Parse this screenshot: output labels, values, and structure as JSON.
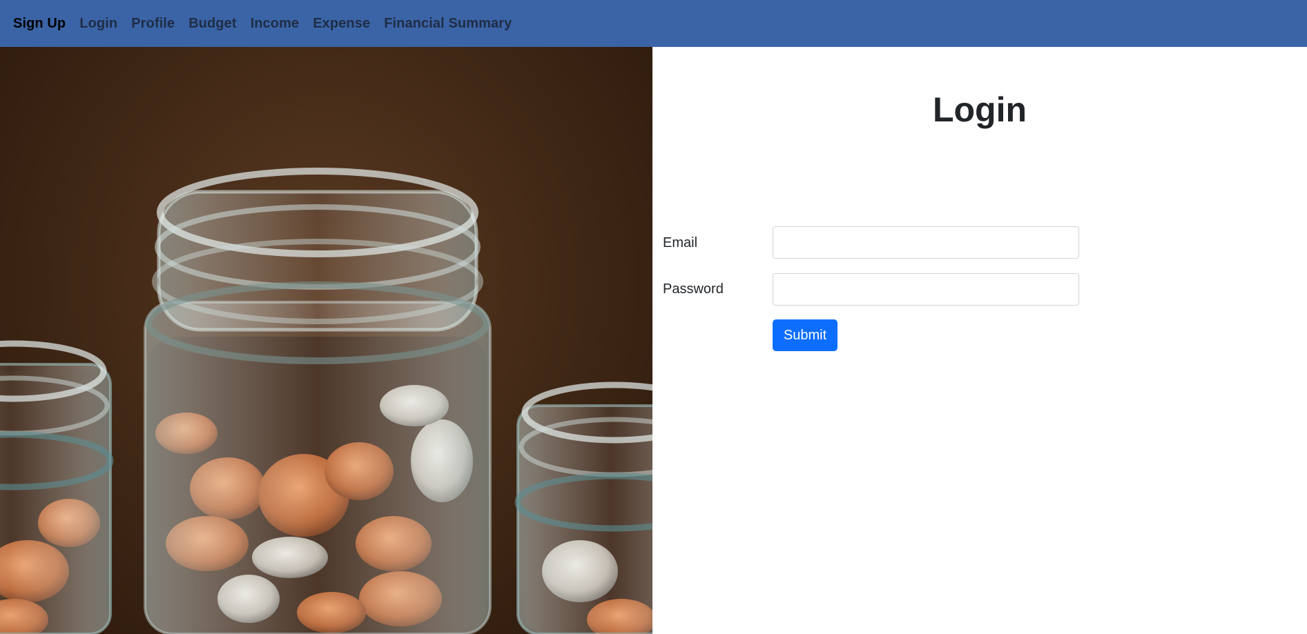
{
  "nav": {
    "items": [
      {
        "label": "Sign Up",
        "active": true
      },
      {
        "label": "Login",
        "active": false
      },
      {
        "label": "Profile",
        "active": false
      },
      {
        "label": "Budget",
        "active": false
      },
      {
        "label": "Income",
        "active": false
      },
      {
        "label": "Expense",
        "active": false
      },
      {
        "label": "Financial Summary",
        "active": false
      }
    ],
    "background": "#3a64a6"
  },
  "hero": {
    "image": "coin-jars-photo"
  },
  "login": {
    "title": "Login",
    "email_label": "Email",
    "email_value": "",
    "password_label": "Password",
    "password_value": "",
    "submit_label": "Submit",
    "submit_color": "#0d6efd"
  }
}
